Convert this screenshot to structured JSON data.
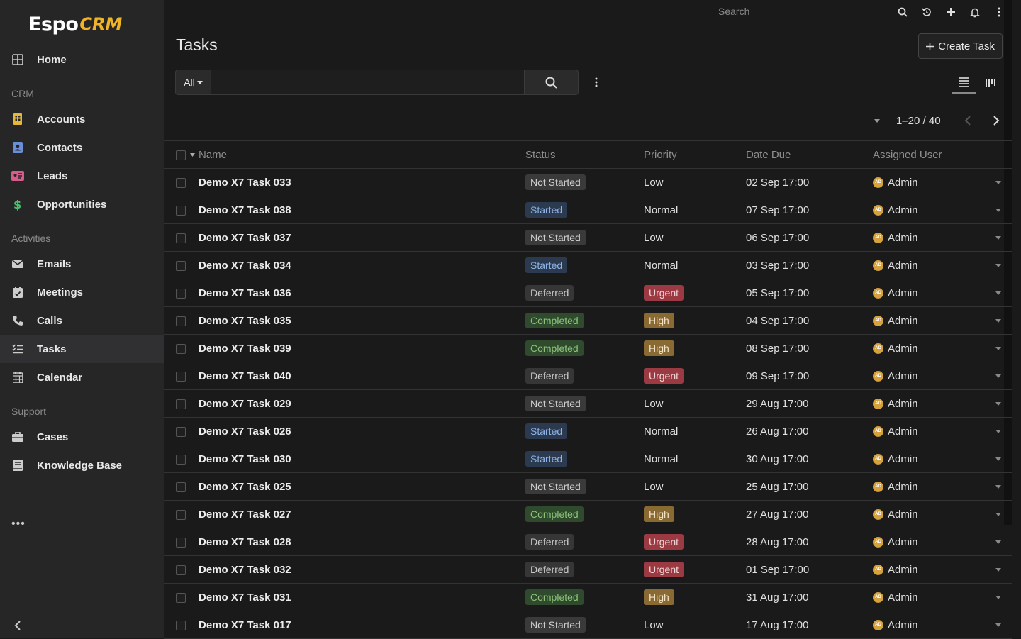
{
  "app": {
    "logo_text": "Espo",
    "logo_crm": "CRM"
  },
  "sidebar": {
    "items": [
      {
        "label": "Home",
        "icon": "home-grid-icon"
      },
      {
        "group": "CRM"
      },
      {
        "label": "Accounts",
        "icon": "building-icon"
      },
      {
        "label": "Contacts",
        "icon": "contact-card-icon"
      },
      {
        "label": "Leads",
        "icon": "id-card-icon"
      },
      {
        "label": "Opportunities",
        "icon": "dollar-icon"
      },
      {
        "group": "Activities"
      },
      {
        "label": "Emails",
        "icon": "envelope-icon"
      },
      {
        "label": "Meetings",
        "icon": "calendar-check-icon"
      },
      {
        "label": "Calls",
        "icon": "phone-icon"
      },
      {
        "label": "Tasks",
        "icon": "tasks-icon",
        "active": true
      },
      {
        "label": "Calendar",
        "icon": "calendar-icon"
      },
      {
        "group": "Support"
      },
      {
        "label": "Cases",
        "icon": "briefcase-icon"
      },
      {
        "label": "Knowledge Base",
        "icon": "book-icon"
      }
    ],
    "more": "•••"
  },
  "topbar": {
    "search_placeholder": "Search"
  },
  "page": {
    "title": "Tasks",
    "create_label": "Create Task"
  },
  "filter": {
    "scope": "All",
    "query": ""
  },
  "pager": {
    "range": "1–20 / 40"
  },
  "columns": {
    "name": "Name",
    "status": "Status",
    "priority": "Priority",
    "date_due": "Date Due",
    "assigned": "Assigned User"
  },
  "rows": [
    {
      "name": "Demo X7 Task 033",
      "status": "Not Started",
      "priority": "Low",
      "date": "02 Sep 17:00",
      "user": "Admin"
    },
    {
      "name": "Demo X7 Task 038",
      "status": "Started",
      "priority": "Normal",
      "date": "07 Sep 17:00",
      "user": "Admin"
    },
    {
      "name": "Demo X7 Task 037",
      "status": "Not Started",
      "priority": "Low",
      "date": "06 Sep 17:00",
      "user": "Admin"
    },
    {
      "name": "Demo X7 Task 034",
      "status": "Started",
      "priority": "Normal",
      "date": "03 Sep 17:00",
      "user": "Admin"
    },
    {
      "name": "Demo X7 Task 036",
      "status": "Deferred",
      "priority": "Urgent",
      "date": "05 Sep 17:00",
      "user": "Admin"
    },
    {
      "name": "Demo X7 Task 035",
      "status": "Completed",
      "priority": "High",
      "date": "04 Sep 17:00",
      "user": "Admin"
    },
    {
      "name": "Demo X7 Task 039",
      "status": "Completed",
      "priority": "High",
      "date": "08 Sep 17:00",
      "user": "Admin"
    },
    {
      "name": "Demo X7 Task 040",
      "status": "Deferred",
      "priority": "Urgent",
      "date": "09 Sep 17:00",
      "user": "Admin"
    },
    {
      "name": "Demo X7 Task 029",
      "status": "Not Started",
      "priority": "Low",
      "date": "29 Aug 17:00",
      "user": "Admin"
    },
    {
      "name": "Demo X7 Task 026",
      "status": "Started",
      "priority": "Normal",
      "date": "26 Aug 17:00",
      "user": "Admin"
    },
    {
      "name": "Demo X7 Task 030",
      "status": "Started",
      "priority": "Normal",
      "date": "30 Aug 17:00",
      "user": "Admin"
    },
    {
      "name": "Demo X7 Task 025",
      "status": "Not Started",
      "priority": "Low",
      "date": "25 Aug 17:00",
      "user": "Admin"
    },
    {
      "name": "Demo X7 Task 027",
      "status": "Completed",
      "priority": "High",
      "date": "27 Aug 17:00",
      "user": "Admin"
    },
    {
      "name": "Demo X7 Task 028",
      "status": "Deferred",
      "priority": "Urgent",
      "date": "28 Aug 17:00",
      "user": "Admin"
    },
    {
      "name": "Demo X7 Task 032",
      "status": "Deferred",
      "priority": "Urgent",
      "date": "01 Sep 17:00",
      "user": "Admin"
    },
    {
      "name": "Demo X7 Task 031",
      "status": "Completed",
      "priority": "High",
      "date": "31 Aug 17:00",
      "user": "Admin"
    },
    {
      "name": "Demo X7 Task 017",
      "status": "Not Started",
      "priority": "Low",
      "date": "17 Aug 17:00",
      "user": "Admin"
    }
  ],
  "colors": {
    "accent_logo": "#f0b429",
    "urgent": "#9c3a44",
    "high": "#8a6a33",
    "completed": "#2f4a2c",
    "started": "#2c3a50"
  }
}
